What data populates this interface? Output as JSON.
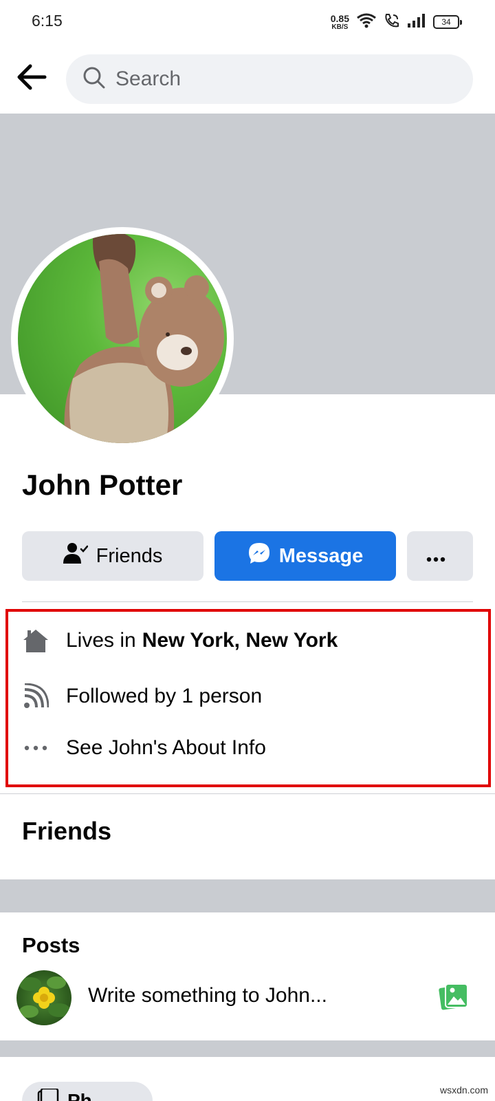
{
  "status_bar": {
    "time": "6:15",
    "net_speed_value": "0.85",
    "net_speed_unit": "KB/S",
    "battery_level": "34"
  },
  "search": {
    "placeholder": "Search"
  },
  "profile": {
    "name": "John Potter"
  },
  "actions": {
    "friends_label": "Friends",
    "message_label": "Message"
  },
  "intro": {
    "lives_prefix": "Lives in",
    "lives_city": "New York, New York",
    "followed_text": "Followed by 1 person",
    "about_text": "See John's About Info"
  },
  "sections": {
    "friends_heading": "Friends",
    "posts_heading": "Posts"
  },
  "composer": {
    "prompt": "Write something to John..."
  },
  "bottom": {
    "chip_label": "Ph"
  },
  "watermark": "wsxdn.com",
  "colors": {
    "brand_blue": "#1b74e4",
    "highlight_red": "#e00000",
    "photo_green": "#45bd62",
    "cover_gray": "#c9ccd1"
  }
}
